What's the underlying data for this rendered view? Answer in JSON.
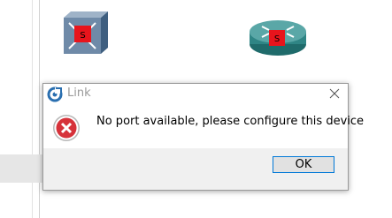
{
  "dialog": {
    "title": "Link",
    "message": "No port available, please configure this device",
    "ok_label": "OK"
  },
  "devices": [
    {
      "type": "switch",
      "badge": "S",
      "badge_color": "#e8141c"
    },
    {
      "type": "router",
      "badge": "S",
      "badge_color": "#e8141c"
    }
  ],
  "colors": {
    "accent": "#0078d7",
    "error": "#d6323a",
    "title_text": "#9a9a9a"
  },
  "icons": {
    "app": "link-app-icon",
    "close": "close-icon",
    "error": "error-icon"
  }
}
